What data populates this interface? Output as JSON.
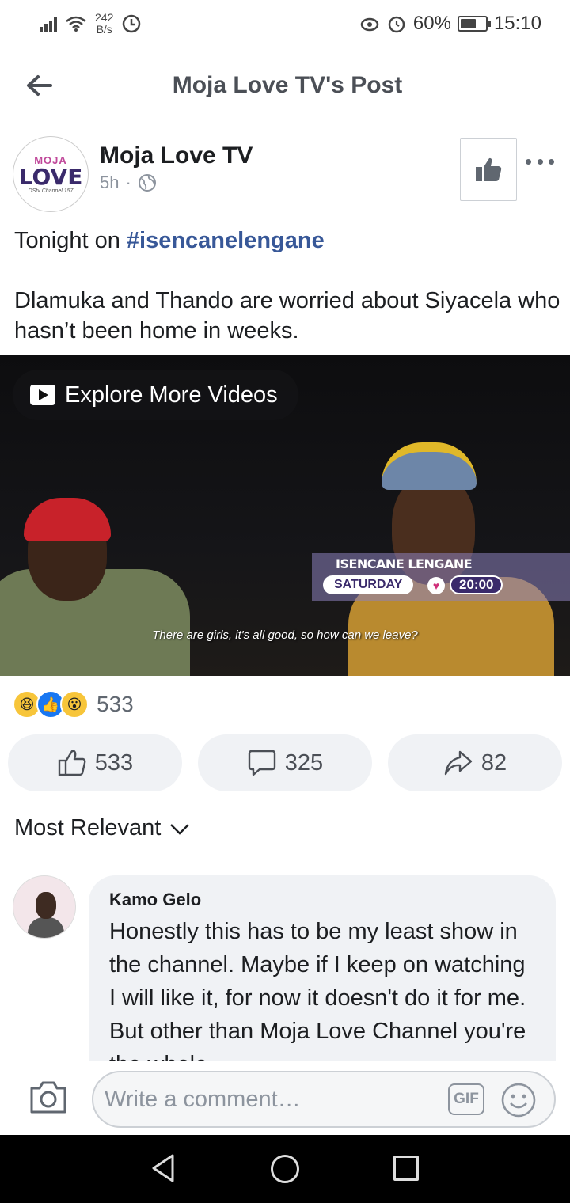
{
  "status_bar": {
    "net_speed_value": "242",
    "net_speed_unit": "B/s",
    "battery_percent": "60%",
    "battery_level": 0.6,
    "time": "15:10"
  },
  "header": {
    "title": "Moja Love TV's Post"
  },
  "post": {
    "page_name": "Moja Love TV",
    "avatar": {
      "line1": "MOJA",
      "line2": "LOVE",
      "line3": "DStv Channel 157"
    },
    "time_ago": "5h",
    "separator": "·",
    "text_prefix": "Tonight on ",
    "hashtag": "#isencanelengane",
    "text_body": "Dlamuka and Thando are worried about Siyacela who hasn’t been home in weeks."
  },
  "video": {
    "explore_label": "Explore More Videos",
    "promo_show": "ISENCANE LENGANE",
    "promo_day": "SATURDAY",
    "promo_time": "20:00",
    "subtitle": "There are girls, it's all good, so how can we leave?"
  },
  "reactions": {
    "count": "533"
  },
  "actions": {
    "like_count": "533",
    "comment_count": "325",
    "share_count": "82"
  },
  "comments": {
    "sort_label": "Most Relevant",
    "items": [
      {
        "author": "Kamo Gelo",
        "text": "Honestly this has to be my least show in the channel. Maybe if I keep on watching I will like it, for now it doesn't do it for me. But other than Moja Love Channel you're the whole"
      }
    ]
  },
  "write_comment": {
    "placeholder": "Write a comment…",
    "gif_label": "GIF"
  },
  "colors": {
    "hashtag": "#385898",
    "button_bg": "#f0f2f5",
    "text_secondary": "#606770"
  }
}
